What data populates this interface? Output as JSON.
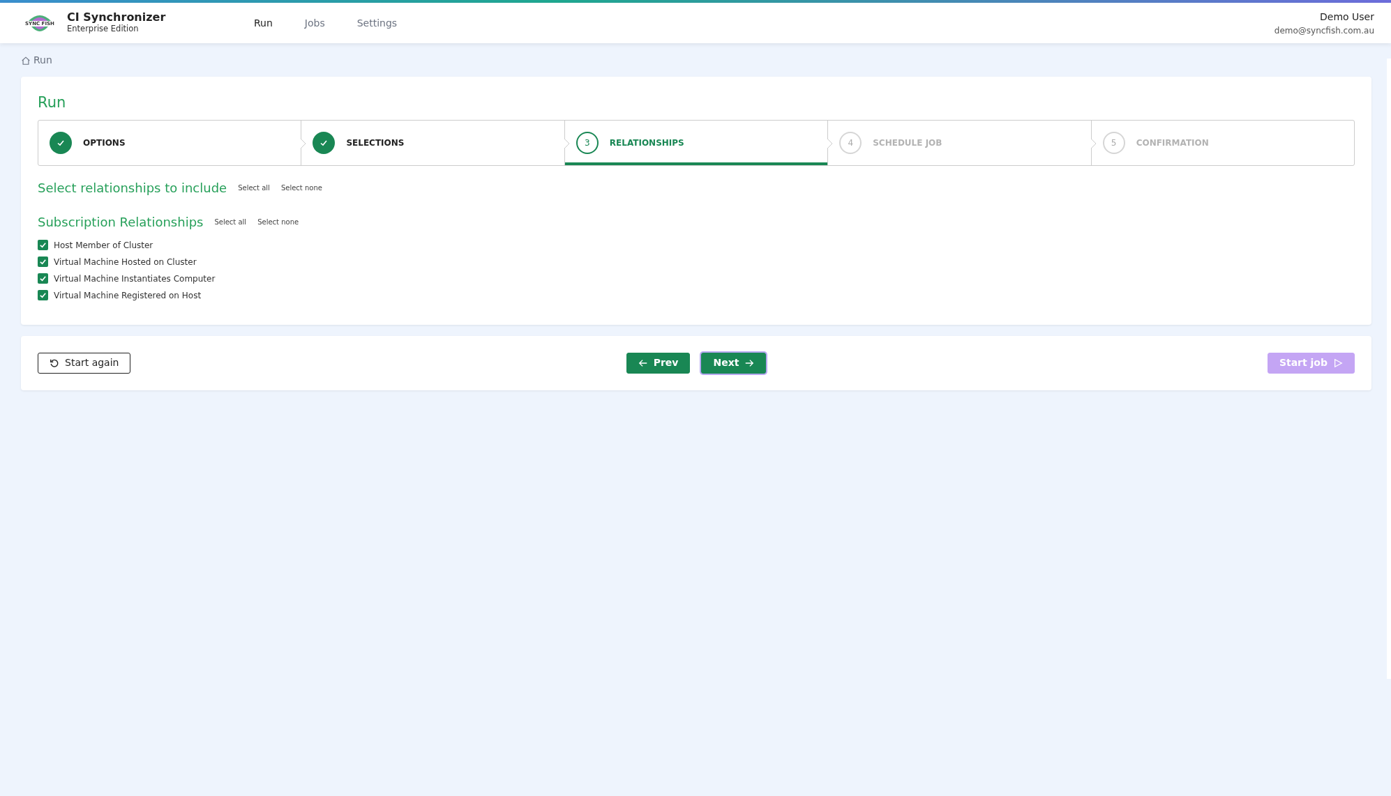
{
  "app": {
    "logo_text": "SYNC FISH",
    "title": "CI Synchronizer",
    "subtitle": "Enterprise Edition"
  },
  "nav": [
    {
      "label": "Run",
      "selected": true
    },
    {
      "label": "Jobs",
      "selected": false
    },
    {
      "label": "Settings",
      "selected": false
    }
  ],
  "user": {
    "name": "Demo User",
    "email": "demo@syncfish.com.au"
  },
  "breadcrumb": "Run",
  "page_title": "Run",
  "steps": [
    {
      "label": "OPTIONS",
      "done": true,
      "selected": false
    },
    {
      "label": "SELECTIONS",
      "done": true,
      "selected": false
    },
    {
      "marker": "3",
      "label": "RELATIONSHIPS",
      "done": false,
      "selected": true
    },
    {
      "marker": "4",
      "label": "SCHEDULE JOB",
      "done": false,
      "selected": false
    },
    {
      "marker": "5",
      "label": "CONFIRMATION",
      "done": false,
      "selected": false
    }
  ],
  "sections": [
    {
      "title": "Select relationships to include",
      "select_all": "Select all",
      "select_none": "Select none"
    },
    {
      "title": "Subscription Relationships",
      "select_all": "Select all",
      "select_none": "Select none",
      "items": [
        {
          "label": "Host Member of Cluster",
          "checked": true
        },
        {
          "label": "Virtual Machine Hosted on Cluster",
          "checked": true
        },
        {
          "label": "Virtual Machine Instantiates Computer",
          "checked": true
        },
        {
          "label": "Virtual Machine Registered on Host",
          "checked": true
        }
      ]
    }
  ],
  "buttons": [
    {
      "kind": "restart",
      "label": "Start again",
      "disabled": false,
      "focused": false
    },
    {
      "kind": "prev",
      "label": "Prev",
      "disabled": false,
      "focused": false
    },
    {
      "kind": "next",
      "label": "Next",
      "disabled": false,
      "focused": true
    },
    {
      "kind": "start",
      "label": "Start job",
      "disabled": true,
      "focused": false
    }
  ]
}
